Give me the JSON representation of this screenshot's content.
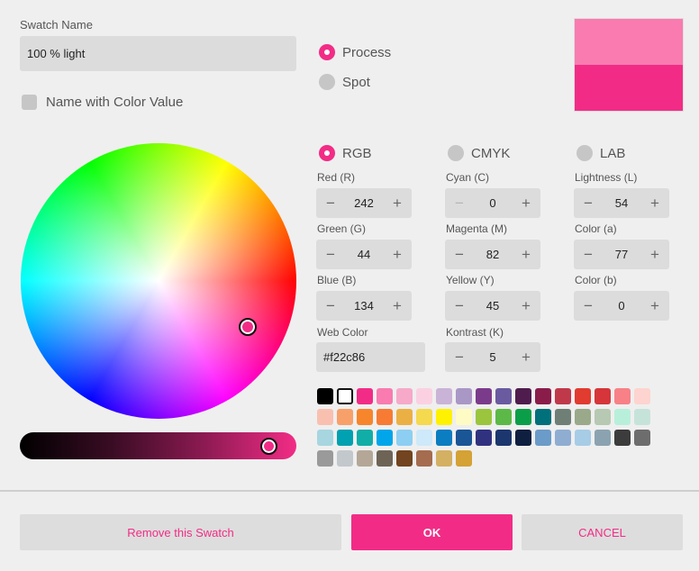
{
  "swatch": {
    "name_label": "Swatch Name",
    "name_value": "100 % light",
    "name_with_value_label": "Name with Color Value",
    "name_with_value_checked": false
  },
  "type": {
    "process_label": "Process",
    "spot_label": "Spot",
    "selected": "Process"
  },
  "preview": {
    "original_color": "#f97bb0",
    "new_color": "#f22c86"
  },
  "mode": {
    "rgb_label": "RGB",
    "cmyk_label": "CMYK",
    "lab_label": "LAB",
    "selected": "RGB"
  },
  "rgb": {
    "red": {
      "label": "Red (R)",
      "value": "242"
    },
    "green": {
      "label": "Green (G)",
      "value": "44"
    },
    "blue": {
      "label": "Blue (B)",
      "value": "134"
    },
    "web_label": "Web Color",
    "web_value": "#f22c86"
  },
  "cmyk": {
    "cyan": {
      "label": "Cyan (C)",
      "value": "0"
    },
    "magenta": {
      "label": "Magenta (M)",
      "value": "82"
    },
    "yellow": {
      "label": "Yellow (Y)",
      "value": "45"
    },
    "key": {
      "label": "Kontrast (K)",
      "value": "5"
    }
  },
  "lab": {
    "lightness": {
      "label": "Lightness (L)",
      "value": "54"
    },
    "a": {
      "label": "Color (a)",
      "value": "77"
    },
    "b": {
      "label": "Color (b)",
      "value": "0"
    }
  },
  "stepper": {
    "minus": "−",
    "plus": "+"
  },
  "palette": [
    "#000000",
    "#ffffff",
    "#f22c86",
    "#f97bb0",
    "#f6a9c9",
    "#fbd1e1",
    "#c9b3d6",
    "#a997c6",
    "#7b3b8b",
    "#6a5aa0",
    "#4f1c4e",
    "#8a1c4a",
    "#c0394a",
    "#e23b30",
    "#d6353a",
    "#f78187",
    "#fdd4cf",
    "#f9c0b0",
    "#f8a06a",
    "#f7852c",
    "#f77b32",
    "#ebb043",
    "#f5d94e",
    "#fff200",
    "#fffbc4",
    "#9bc53d",
    "#5cb947",
    "#0b9e48",
    "#00707a",
    "#6f7f76",
    "#9aa98a",
    "#b7c9b2",
    "#b8efdb",
    "#c6e3da",
    "#a7d6e0",
    "#00a1b0",
    "#11aea7",
    "#00a6e9",
    "#8ccff2",
    "#cde9fa",
    "#0b7dc1",
    "#1a5596",
    "#31327f",
    "#1c376e",
    "#0f1f3f",
    "#6b9bc8",
    "#8fadd1",
    "#a6cce6",
    "#8ba3b0",
    "#3c3c3c",
    "#6d6d6d",
    "#9a9a9a",
    "#c2c8cc",
    "#b4a797",
    "#6e6456",
    "#72441f",
    "#a56c4f",
    "#d4b062",
    "#d4a235"
  ],
  "palette_selected_index": 1,
  "wheel": {
    "hue_deg": 330,
    "saturation": 0.82
  },
  "lightness_slider": {
    "value": 0.9
  },
  "footer": {
    "remove_label": "Remove this Swatch",
    "ok_label": "OK",
    "cancel_label": "CANCEL"
  },
  "colors": {
    "accent": "#f22c86"
  }
}
